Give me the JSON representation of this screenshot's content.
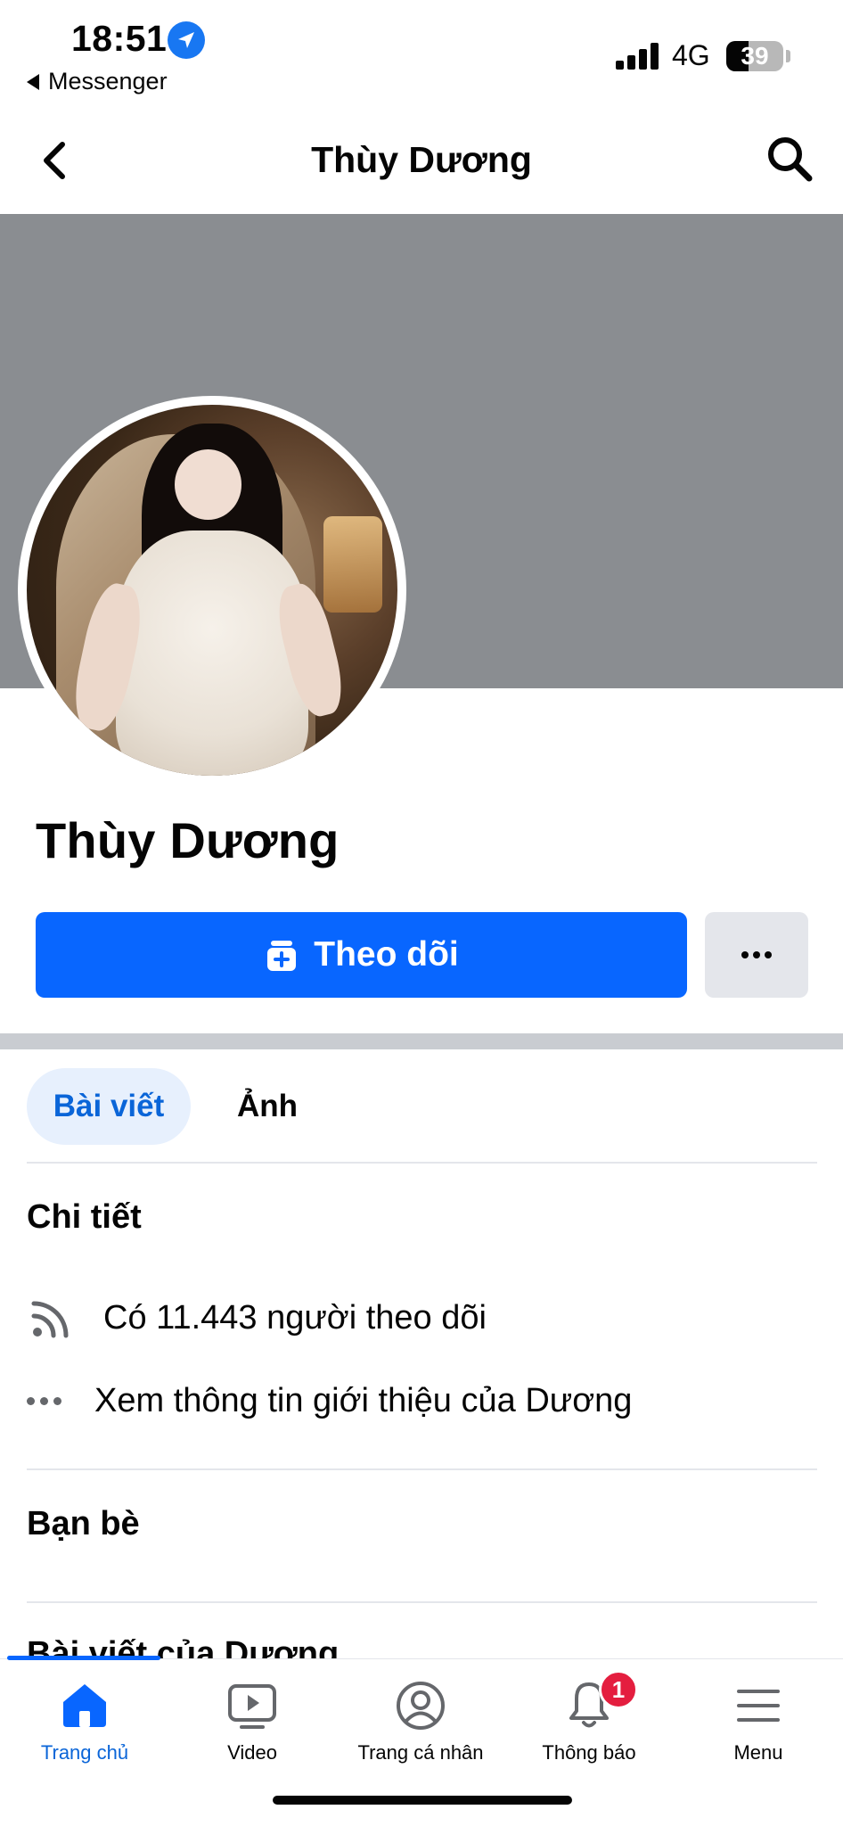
{
  "status_bar": {
    "time": "18:51",
    "back_app": "Messenger",
    "network": "4G",
    "battery": "39",
    "battery_level": 0.39
  },
  "header": {
    "title": "Thùy Dương",
    "back_icon": "chevron-left-icon",
    "search_icon": "search-icon"
  },
  "profile": {
    "name": "Thùy Dương",
    "follow_label": "Theo dõi",
    "follow_icon": "follow-plus-icon"
  },
  "tabs": [
    {
      "label": "Bài viết",
      "active": true
    },
    {
      "label": "Ảnh",
      "active": false
    }
  ],
  "details": {
    "title": "Chi tiết",
    "followers": "Có 11.443 người theo dõi",
    "about": "Xem thông tin giới thiệu của Dương"
  },
  "friends": {
    "title": "Bạn bè"
  },
  "posts": {
    "title": "Bài viết của Dương"
  },
  "bottom_nav": [
    {
      "label": "Trang chủ",
      "icon": "home-icon",
      "active": true
    },
    {
      "label": "Video",
      "icon": "video-icon",
      "active": false
    },
    {
      "label": "Trang cá nhân",
      "icon": "profile-icon",
      "active": false
    },
    {
      "label": "Thông báo",
      "icon": "bell-icon",
      "active": false,
      "badge": "1"
    },
    {
      "label": "Menu",
      "icon": "menu-icon",
      "active": false
    }
  ],
  "colors": {
    "accent": "#0866ff",
    "active_text": "#0a65d8",
    "cover": "#8a8d91",
    "badge": "#e41e3f"
  }
}
